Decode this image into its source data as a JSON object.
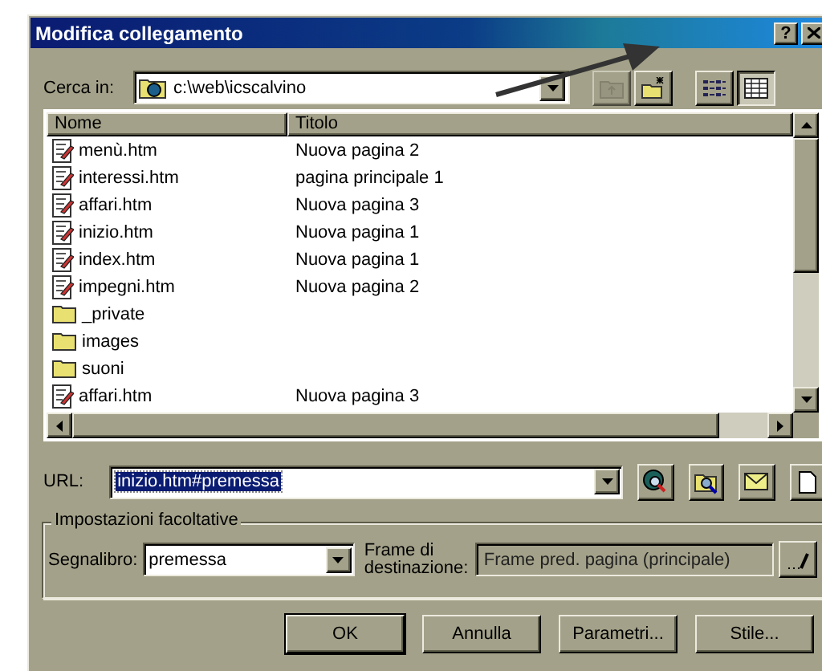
{
  "window": {
    "title": "Modifica collegamento",
    "help_button": "?"
  },
  "look_in": {
    "label": "Cerca in:",
    "value": "c:\\web\\icscalvino"
  },
  "toolbar": [
    {
      "kind": "up-folder",
      "disabled": true,
      "pressed": false
    },
    {
      "kind": "new-folder",
      "disabled": false,
      "pressed": false
    },
    {
      "kind": "list-view",
      "disabled": false,
      "pressed": false
    },
    {
      "kind": "details-view",
      "disabled": false,
      "pressed": true
    }
  ],
  "file_list": {
    "columns": [
      "Nome",
      "Titolo"
    ],
    "rows": [
      {
        "kind": "page",
        "name": "menù.htm",
        "title": "Nuova pagina 2"
      },
      {
        "kind": "page",
        "name": "interessi.htm",
        "title": "pagina principale 1"
      },
      {
        "kind": "page",
        "name": "affari.htm",
        "title": "Nuova pagina 3"
      },
      {
        "kind": "page",
        "name": "inizio.htm",
        "title": "Nuova pagina 1"
      },
      {
        "kind": "page",
        "name": "index.htm",
        "title": "Nuova pagina 1"
      },
      {
        "kind": "page",
        "name": "impegni.htm",
        "title": "Nuova pagina 2"
      },
      {
        "kind": "folder",
        "name": "_private"
      },
      {
        "kind": "folder",
        "name": "images"
      },
      {
        "kind": "folder",
        "name": "suoni"
      },
      {
        "kind": "page",
        "name": "affari.htm",
        "title": "Nuova pagina 3"
      }
    ]
  },
  "url": {
    "label": "URL:",
    "value": "inizio.htm#premessa",
    "selected": true
  },
  "options": {
    "legend": "Impostazioni facoltative",
    "bookmark_label": "Segnalibro:",
    "bookmark_value": "premessa",
    "frame_label": "Frame di destinazione:",
    "frame_value": "Frame pred. pagina (principale)"
  },
  "buttons": [
    {
      "label": "OK",
      "default": true
    },
    {
      "label": "Annulla",
      "default": false
    },
    {
      "label": "Parametri...",
      "default": false
    },
    {
      "label": "Stile...",
      "default": false
    }
  ],
  "annotation": {
    "kind": "arrow"
  }
}
